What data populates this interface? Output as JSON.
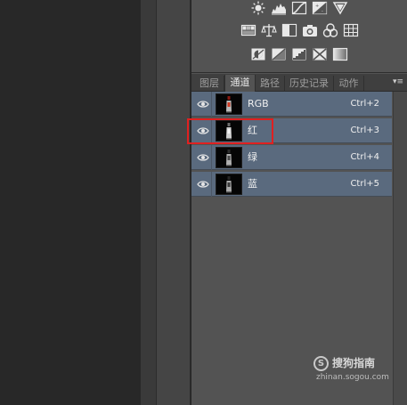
{
  "tabs": [
    {
      "label": "图层",
      "active": false
    },
    {
      "label": "通道",
      "active": true
    },
    {
      "label": "路径",
      "active": false
    },
    {
      "label": "历史记录",
      "active": false
    },
    {
      "label": "动作",
      "active": false
    }
  ],
  "panel_menu_icon": "▾≡",
  "channels": [
    {
      "name": "RGB",
      "shortcut": "Ctrl+2",
      "visible": true
    },
    {
      "name": "红",
      "shortcut": "Ctrl+3",
      "visible": true
    },
    {
      "name": "绿",
      "shortcut": "Ctrl+4",
      "visible": true
    },
    {
      "name": "蓝",
      "shortcut": "Ctrl+5",
      "visible": true
    }
  ],
  "adjustment_icons": [
    [
      "brightness-contrast-icon",
      "levels-icon",
      "curves-icon",
      "exposure-icon",
      "vibrance-icon"
    ],
    [
      "hue-saturation-icon",
      "color-balance-icon",
      "black-white-icon",
      "photo-filter-icon",
      "channel-mixer-icon",
      "color-lookup-icon"
    ],
    [
      "invert-icon",
      "posterize-icon",
      "threshold-icon",
      "selective-color-icon",
      "gradient-map-icon"
    ]
  ],
  "watermark": {
    "logo": "S",
    "name": "搜狗指南",
    "url": "zhinan.sogou.com"
  },
  "colors": {
    "selected_row": "#5a6a7e",
    "highlight_box": "#e02020",
    "panel_bg": "#535353"
  }
}
